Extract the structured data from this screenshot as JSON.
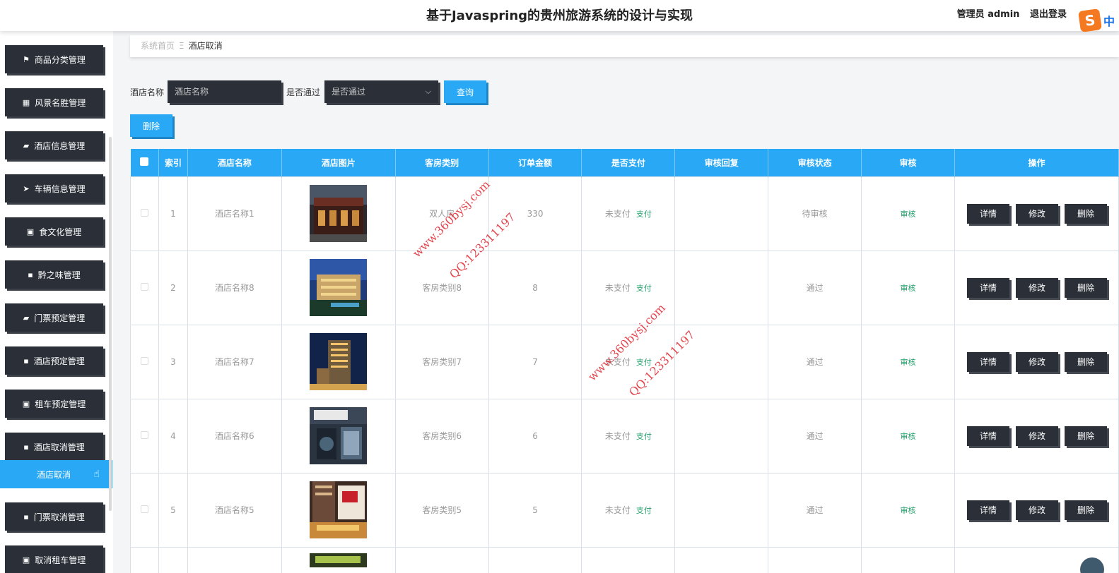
{
  "header": {
    "title": "基于Javaspring的贵州旅游系统的设计与实现",
    "user_label": "管理员 admin",
    "logout_label": "退出登录",
    "brand_letter": "S",
    "brand_text": "中"
  },
  "sidebar": {
    "items": [
      {
        "label": "商品分类管理",
        "icon": "flag-icon",
        "glyph": "⚑"
      },
      {
        "label": "风景名胜管理",
        "icon": "grid-icon",
        "glyph": "▦"
      },
      {
        "label": "酒店信息管理",
        "icon": "briefcase-icon",
        "glyph": "▰"
      },
      {
        "label": "车辆信息管理",
        "icon": "send-icon",
        "glyph": "➤"
      },
      {
        "label": "食文化管理",
        "icon": "clipboard-icon",
        "glyph": "▣"
      },
      {
        "label": "黔之味管理",
        "icon": "apps-icon",
        "glyph": "▪"
      },
      {
        "label": "门票预定管理",
        "icon": "ticket-icon",
        "glyph": "▰"
      },
      {
        "label": "酒店预定管理",
        "icon": "apps-icon",
        "glyph": "▪"
      },
      {
        "label": "租车预定管理",
        "icon": "clipboard-check-icon",
        "glyph": "▣"
      },
      {
        "label": "酒店取消管理",
        "icon": "apps-icon",
        "glyph": "▪"
      },
      {
        "label": "门票取消管理",
        "icon": "apps-icon",
        "glyph": "▪"
      },
      {
        "label": "取消租车管理",
        "icon": "clipboard-check-icon",
        "glyph": "▣"
      }
    ],
    "active_sub": "酒店取消"
  },
  "breadcrumb": {
    "home": "系统首页",
    "sep": "Ξ",
    "current": "酒店取消"
  },
  "search": {
    "name_label": "酒店名称",
    "name_placeholder": "酒店名称",
    "pass_label": "是否通过",
    "pass_value": "是否通过",
    "query_label": "查询",
    "delete_label": "删除"
  },
  "table": {
    "headers": [
      "索引",
      "酒店名称",
      "酒店图片",
      "客房类别",
      "订单金额",
      "是否支付",
      "审核回复",
      "审核状态",
      "审核",
      "操作"
    ],
    "rows": [
      {
        "index": "1",
        "name": "酒店名称1",
        "room": "双人房",
        "amount": "330",
        "paid": "未支付",
        "pay_action": "支付",
        "reply": "",
        "status": "待审核",
        "audit": "审核"
      },
      {
        "index": "2",
        "name": "酒店名称8",
        "room": "客房类别8",
        "amount": "8",
        "paid": "未支付",
        "pay_action": "支付",
        "reply": "",
        "status": "通过",
        "audit": "审核"
      },
      {
        "index": "3",
        "name": "酒店名称7",
        "room": "客房类别7",
        "amount": "7",
        "paid": "未支付",
        "pay_action": "支付",
        "reply": "",
        "status": "通过",
        "audit": "审核"
      },
      {
        "index": "4",
        "name": "酒店名称6",
        "room": "客房类别6",
        "amount": "6",
        "paid": "未支付",
        "pay_action": "支付",
        "reply": "",
        "status": "通过",
        "audit": "审核"
      },
      {
        "index": "5",
        "name": "酒店名称5",
        "room": "客房类别5",
        "amount": "5",
        "paid": "未支付",
        "pay_action": "支付",
        "reply": "",
        "status": "通过",
        "audit": "审核"
      }
    ],
    "ops": {
      "detail": "详情",
      "edit": "修改",
      "delete": "删除"
    }
  },
  "watermarks": {
    "site": "www.360bysj.com",
    "qq": "QQ:123311197"
  },
  "colors": {
    "accent": "#29a8f6",
    "dark": "#2b3038",
    "success": "#22a06b",
    "watermark": "#e0242e"
  }
}
